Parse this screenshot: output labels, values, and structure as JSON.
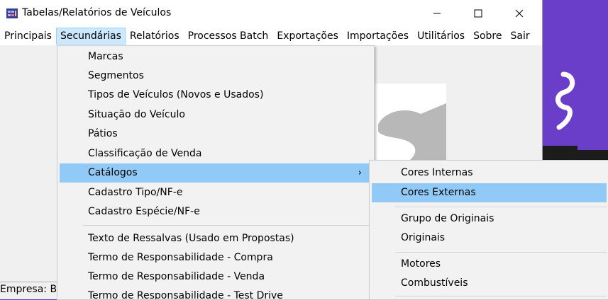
{
  "window": {
    "title": "Tabelas/Relatórios de Veículos",
    "minimize": "—",
    "maximize": "☐",
    "close": "✕"
  },
  "menubar": {
    "items": [
      "Principais",
      "Secundárias",
      "Relatórios",
      "Processos Batch",
      "Exportações",
      "Importações",
      "Utilitários",
      "Sobre",
      "Sair"
    ],
    "active": "Secundárias"
  },
  "dropdown": {
    "items": [
      "Marcas",
      "Segmentos",
      "Tipos de Veículos (Novos e Usados)",
      "Situação do Veículo",
      "Pátios",
      "Classificação de Venda",
      "Catálogos",
      "Cadastro Tipo/NF-e",
      "Cadastro Espécie/NF-e",
      "Texto de Ressalvas (Usado em Propostas)",
      "Termo de Responsabilidade - Compra",
      "Termo de Responsabilidade - Venda",
      "Termo de Responsabilidade - Test Drive"
    ],
    "highlighted": "Catálogos",
    "submenu_arrow": "›"
  },
  "submenu": {
    "items": [
      "Cores Internas",
      "Cores Externas",
      "Grupo de Originais",
      "Originais",
      "Motores",
      "Combustíveis"
    ],
    "highlighted": "Cores Externas"
  },
  "statusbar": {
    "text": "Empresa: Be"
  },
  "colors": {
    "highlight": "#91c9f7",
    "menu_active": "#cce8ff",
    "desktop": "#6a3ec9"
  }
}
